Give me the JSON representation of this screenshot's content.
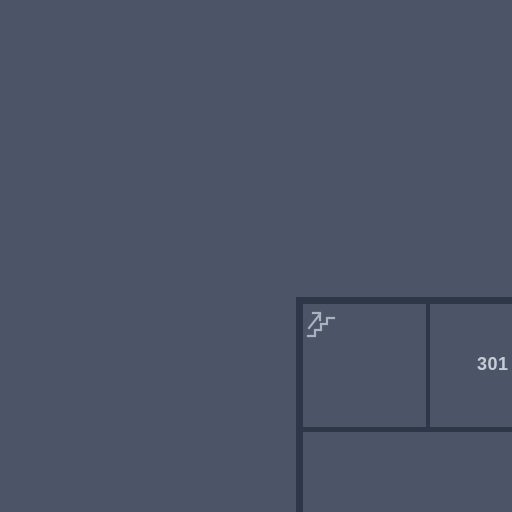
{
  "floor_plan": {
    "rooms": [
      {
        "id": "stairwell",
        "label": "",
        "icon": "stairs-up-icon"
      },
      {
        "id": "room-301",
        "label": "301"
      },
      {
        "id": "room-lower",
        "label": ""
      }
    ]
  },
  "colors": {
    "background": "#4b5567",
    "wall": "#2e3747",
    "label": "#c7cdd6",
    "icon": "#aab2bf"
  }
}
